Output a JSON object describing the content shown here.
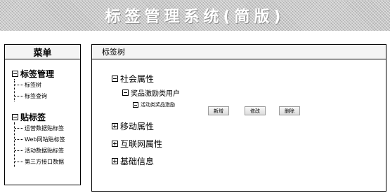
{
  "banner": {
    "title": "标签管理系统(简版)"
  },
  "menu": {
    "title": "菜单",
    "sections": [
      {
        "label": "标签管理",
        "items": [
          "标签树",
          "标签查询"
        ]
      },
      {
        "label": "贴标签",
        "items": [
          "运营数据贴标签",
          "Web网站贴标签",
          "活动数据贴标签",
          "第三方接口数据"
        ]
      }
    ]
  },
  "main": {
    "title": "标签树",
    "tree": {
      "social": "社会属性",
      "reward_users": "奖品激励类用户",
      "activity_reward": "活动类奖品激励",
      "mobile": "移动属性",
      "internet": "互联网属性",
      "basic": "基础信息"
    },
    "buttons": {
      "add": "新增",
      "edit": "修改",
      "delete": "删除"
    }
  }
}
